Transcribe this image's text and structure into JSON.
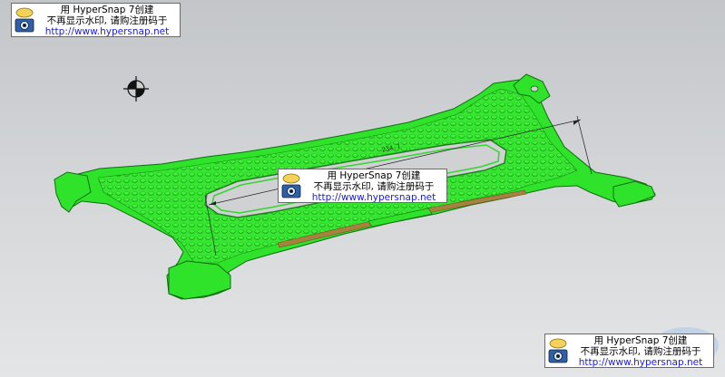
{
  "watermark": {
    "line1": "用 HyperSnap 7创建",
    "line2": "不再显示水印, 请购注册码于",
    "line3": "http://www.hypersnap.net"
  },
  "model": {
    "dimension_value": "234.1"
  },
  "icons": [
    "camera-icon",
    "crosshair-icon",
    "site-logo"
  ],
  "colors": {
    "background": "#d0d2d4",
    "part_green": "#2fe22a",
    "part_edge": "#0f6e10",
    "rail": "#a7823f",
    "dimension": "#222222"
  }
}
